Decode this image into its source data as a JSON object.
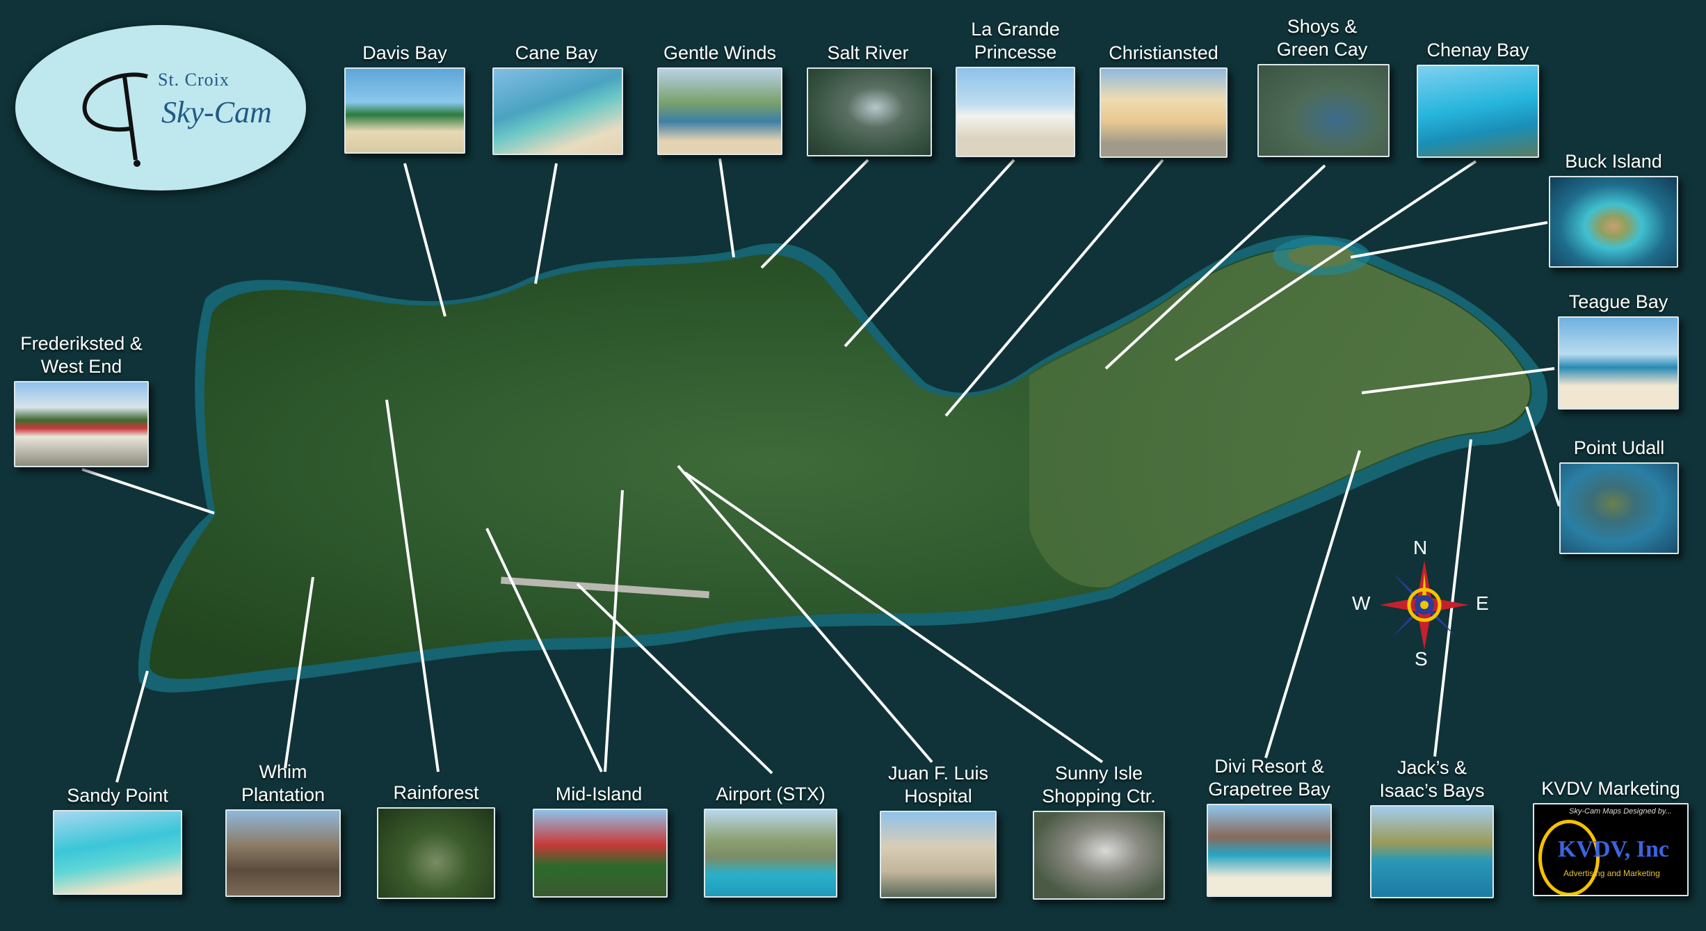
{
  "logo": {
    "small": "St. Croix",
    "big": "Sky-Cam"
  },
  "compass": {
    "n": "N",
    "s": "S",
    "e": "E",
    "w": "W"
  },
  "places": [
    {
      "id": "davis-bay",
      "label": "Davis Bay"
    },
    {
      "id": "cane-bay",
      "label": "Cane Bay"
    },
    {
      "id": "gentle-winds",
      "label": "Gentle Winds"
    },
    {
      "id": "salt-river",
      "label": "Salt River"
    },
    {
      "id": "la-grande-princesse",
      "label": "La Grande\nPrincesse"
    },
    {
      "id": "christiansted",
      "label": "Christiansted"
    },
    {
      "id": "shoys-green-cay",
      "label": "Shoys &\nGreen Cay"
    },
    {
      "id": "chenay-bay",
      "label": "Chenay Bay"
    },
    {
      "id": "buck-island",
      "label": "Buck Island"
    },
    {
      "id": "teague-bay",
      "label": "Teague Bay"
    },
    {
      "id": "point-udall",
      "label": "Point Udall"
    },
    {
      "id": "frederiksted",
      "label": "Frederiksted &\nWest End"
    },
    {
      "id": "sandy-point",
      "label": "Sandy Point"
    },
    {
      "id": "whim-plantation",
      "label": "Whim\nPlantation"
    },
    {
      "id": "rainforest",
      "label": "Rainforest"
    },
    {
      "id": "mid-island",
      "label": "Mid-Island"
    },
    {
      "id": "airport",
      "label": "Airport (STX)"
    },
    {
      "id": "juan-f-luis",
      "label": "Juan F. Luis\nHospital"
    },
    {
      "id": "sunny-isle",
      "label": "Sunny Isle\nShopping Ctr."
    },
    {
      "id": "divi-resort",
      "label": "Divi Resort &\nGrapetree Bay"
    },
    {
      "id": "jacks-isaacs",
      "label": "Jack’s &\nIsaac’s Bays"
    },
    {
      "id": "kvdv-marketing",
      "label": "KVDV Marketing"
    }
  ],
  "kvdv": {
    "tagline": "Sky-Cam Maps Designed by...",
    "name": "KVDV, Inc",
    "sub": "Advertising and Marketing"
  }
}
